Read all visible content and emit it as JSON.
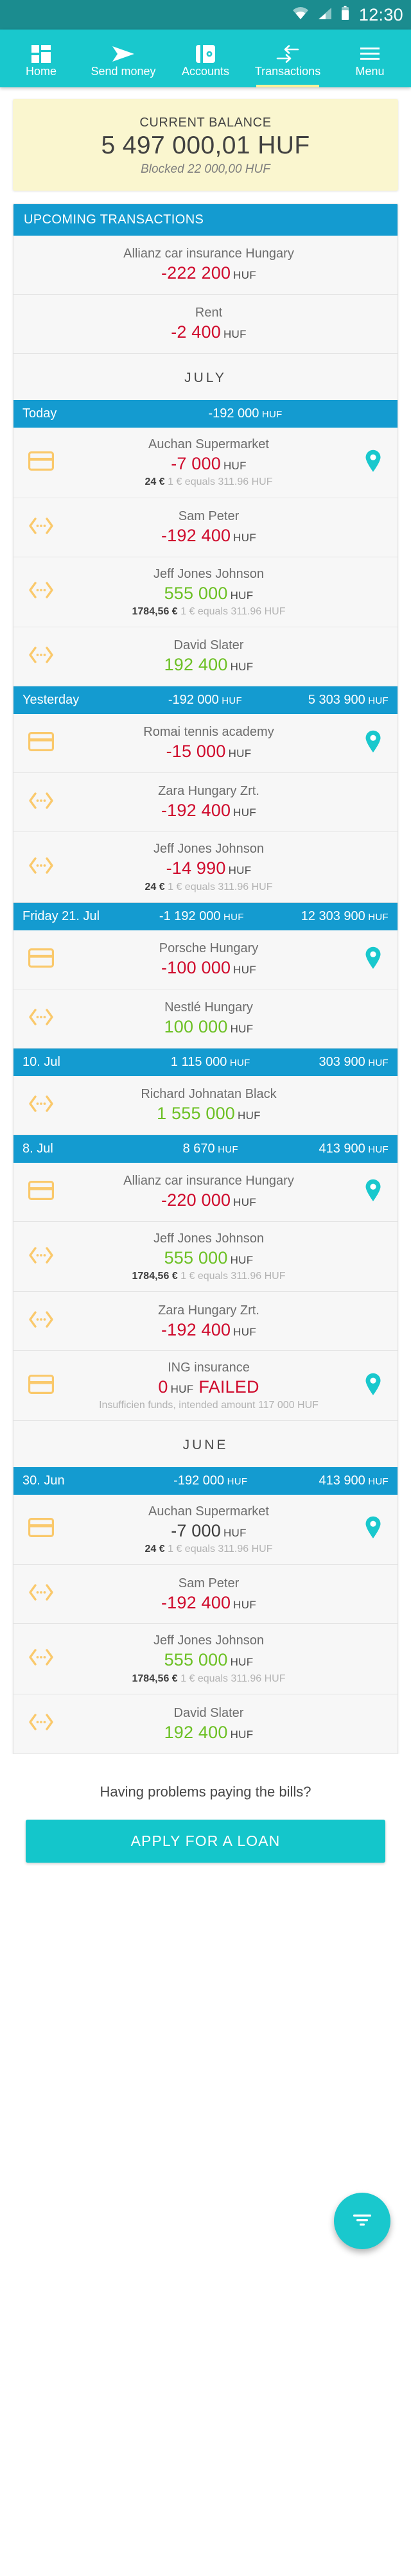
{
  "status_bar": {
    "time": "12:30",
    "icons": [
      "wifi-icon",
      "cellular-signal-icon",
      "battery-icon"
    ]
  },
  "nav": {
    "items": [
      {
        "label": "Home",
        "icon": "dashboard-grid-icon",
        "active": false
      },
      {
        "label": "Send money",
        "icon": "send-arrow-icon",
        "active": false
      },
      {
        "label": "Accounts",
        "icon": "wallet-icon",
        "active": false
      },
      {
        "label": "Transactions",
        "icon": "transfer-arrows-icon",
        "active": true
      },
      {
        "label": "Menu",
        "icon": "hamburger-menu-icon",
        "active": false
      }
    ]
  },
  "balance": {
    "title": "CURRENT BALANCE",
    "amount": "5 497 000,01 HUF",
    "blocked": "Blocked 22 000,00 HUF"
  },
  "upcoming": {
    "header": "UPCOMING TRANSACTIONS",
    "rows": [
      {
        "name": "Allianz car insurance Hungary",
        "amount": "-222 200",
        "currency": "HUF",
        "sign": "neg"
      },
      {
        "name": "Rent",
        "amount": "-2 400",
        "currency": "HUF",
        "sign": "neg"
      }
    ]
  },
  "months": [
    {
      "label": "JULY",
      "days": [
        {
          "label": "Today",
          "sum": "-192 000",
          "sum_currency": "HUF",
          "balance": "",
          "balance_currency": "",
          "rows": [
            {
              "icon": "credit-card-icon",
              "name": "Auchan Supermarket",
              "amount": "-7 000",
              "currency": "HUF",
              "sign": "neg",
              "fx_amount": "24 €",
              "fx_rate": "1 € equals 311.96 HUF",
              "pin": true
            },
            {
              "icon": "transfer-icon",
              "name": "Sam Peter",
              "amount": "-192 400",
              "currency": "HUF",
              "sign": "neg",
              "pin": false
            },
            {
              "icon": "transfer-icon",
              "name": "Jeff Jones Johnson",
              "amount": "555 000",
              "currency": "HUF",
              "sign": "pos",
              "fx_amount": "1784,56 €",
              "fx_rate": "1 € equals 311.96 HUF",
              "pin": false
            },
            {
              "icon": "transfer-icon",
              "name": "David Slater",
              "amount": "192 400",
              "currency": "HUF",
              "sign": "pos",
              "pin": false
            }
          ]
        },
        {
          "label": "Yesterday",
          "sum": "-192 000",
          "sum_currency": "HUF",
          "balance": "5 303 900",
          "balance_currency": "HUF",
          "rows": [
            {
              "icon": "credit-card-icon",
              "name": "Romai tennis academy",
              "amount": "-15 000",
              "currency": "HUF",
              "sign": "neg",
              "pin": true
            },
            {
              "icon": "transfer-icon",
              "name": "Zara Hungary Zrt.",
              "amount": "-192 400",
              "currency": "HUF",
              "sign": "neg",
              "pin": false
            },
            {
              "icon": "transfer-icon",
              "name": "Jeff Jones Johnson",
              "amount": "-14 990",
              "currency": "HUF",
              "sign": "neg",
              "fx_amount": "24 €",
              "fx_rate": "1 € equals 311.96 HUF",
              "pin": false
            }
          ]
        },
        {
          "label": "Friday 21. Jul",
          "sum": "-1 192 000",
          "sum_currency": "HUF",
          "balance": "12 303 900",
          "balance_currency": "HUF",
          "rows": [
            {
              "icon": "credit-card-icon",
              "name": "Porsche Hungary",
              "amount": "-100 000",
              "currency": "HUF",
              "sign": "neg",
              "pin": true
            },
            {
              "icon": "transfer-icon",
              "name": "Nestlé Hungary",
              "amount": "100 000",
              "currency": "HUF",
              "sign": "pos",
              "pin": false
            }
          ]
        },
        {
          "label": "10. Jul",
          "sum": "1 115 000",
          "sum_currency": "HUF",
          "balance": "303 900",
          "balance_currency": "HUF",
          "rows": [
            {
              "icon": "transfer-icon",
              "name": "Richard Johnatan Black",
              "amount": "1 555 000",
              "currency": "HUF",
              "sign": "pos",
              "pin": false
            }
          ]
        },
        {
          "label": "8. Jul",
          "sum": "8 670",
          "sum_currency": "HUF",
          "balance": "413 900",
          "balance_currency": "HUF",
          "rows": [
            {
              "icon": "credit-card-icon",
              "name": "Allianz car insurance Hungary",
              "amount": "-220 000",
              "currency": "HUF",
              "sign": "neg",
              "pin": true
            },
            {
              "icon": "transfer-icon",
              "name": "Jeff Jones Johnson",
              "amount": "555 000",
              "currency": "HUF",
              "sign": "pos",
              "fx_amount": "1784,56 €",
              "fx_rate": "1 € equals 311.96 HUF",
              "pin": false
            },
            {
              "icon": "transfer-icon",
              "name": "Zara Hungary Zrt.",
              "amount": "-192 400",
              "currency": "HUF",
              "sign": "neg",
              "pin": false
            },
            {
              "icon": "credit-card-icon",
              "name": "ING insurance",
              "amount": "0",
              "currency": "HUF",
              "sign": "neg",
              "status": "FAILED",
              "note": "Insufficien funds, intended amount 117 000 HUF",
              "pin": true
            }
          ]
        }
      ]
    },
    {
      "label": "JUNE",
      "days": [
        {
          "label": "30. Jun",
          "sum": "-192 000",
          "sum_currency": "HUF",
          "balance": "413 900",
          "balance_currency": "HUF",
          "rows": [
            {
              "icon": "credit-card-icon",
              "name": "Auchan Supermarket",
              "amount": "-7 000",
              "currency": "HUF",
              "sign": "dark",
              "fx_amount": "24 €",
              "fx_rate": "1 € equals 311.96 HUF",
              "pin": true
            },
            {
              "icon": "transfer-icon",
              "name": "Sam Peter",
              "amount": "-192 400",
              "currency": "HUF",
              "sign": "neg",
              "pin": false
            },
            {
              "icon": "transfer-icon",
              "name": "Jeff Jones Johnson",
              "amount": "555 000",
              "currency": "HUF",
              "sign": "pos",
              "fx_amount": "1784,56 €",
              "fx_rate": "1 € equals 311.96 HUF",
              "pin": false
            },
            {
              "icon": "transfer-icon",
              "name": "David Slater",
              "amount": "192 400",
              "currency": "HUF",
              "sign": "pos",
              "pin": false
            }
          ]
        }
      ]
    }
  ],
  "fab": {
    "icon": "filter-icon"
  },
  "promo": {
    "text": "Having problems paying the bills?",
    "button": "APPLY FOR A LOAN"
  },
  "colors": {
    "teal": "#19c8cd",
    "blue_header": "#149bd0",
    "status_bar": "#1b8c8f",
    "negative": "#cf0a2c",
    "positive": "#6cc024",
    "card_yellow": "#faf6cf",
    "icon_orange": "#fac96c",
    "pin_teal": "#19c8cd",
    "active_underline": "#f7f09a"
  }
}
